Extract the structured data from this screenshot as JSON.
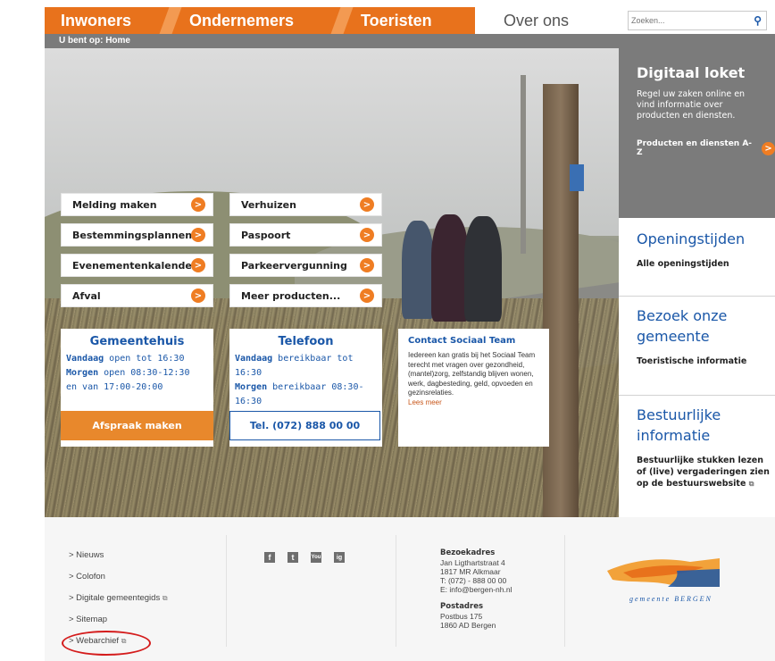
{
  "nav": {
    "tabs": [
      "Inwoners",
      "Ondernemers",
      "Toeristen",
      "Over ons"
    ],
    "search_placeholder": "Zoeken..."
  },
  "breadcrumb": "U bent op: Home",
  "hero_links": {
    "left": [
      "Melding maken",
      "Bestemmingsplannen",
      "Evenementenkalender",
      "Afval"
    ],
    "right": [
      "Verhuizen",
      "Paspoort",
      "Parkeervergunning",
      "Meer producten..."
    ]
  },
  "gemeentehuis": {
    "title": "Gemeentehuis",
    "line1_label": "Vandaag",
    "line1_text": " open tot 16:30",
    "line2_label": "Morgen",
    "line2_text": " open 08:30-12:30",
    "line3_text": "en van 17:00-20:00",
    "button": "Afspraak maken"
  },
  "telefoon": {
    "title": "Telefoon",
    "line1_label": "Vandaag",
    "line1_text": " bereikbaar tot 16:30",
    "line2_label": "Morgen",
    "line2_text": " bereikbaar 08:30-16:30",
    "button": "Tel. (072) 888 00 00"
  },
  "sociaal": {
    "title": "Contact Sociaal Team",
    "body": "Iedereen kan gratis bij het Sociaal Team terecht met vragen over gezondheid, (mantel)zorg, zelfstandig blijven wonen, werk, dagbesteding, geld, opvoeden en gezinsrelaties.",
    "more": "Lees meer"
  },
  "loket": {
    "title": "Digitaal loket",
    "desc": "Regel uw zaken online en vind informatie over producten en diensten.",
    "link": "Producten en diensten A-Z"
  },
  "right_blocks": [
    {
      "title": "Openingstijden",
      "link": "Alle openingstijden"
    },
    {
      "title": "Bezoek onze gemeente",
      "link": "Toeristische informatie"
    },
    {
      "title": "Bestuurlijke informatie",
      "link": "Bestuurlijke stukken lezen of (live) vergaderingen zien op de bestuurswebsite"
    }
  ],
  "footer": {
    "links": [
      "> Nieuws",
      "> Colofon",
      "> Digitale gemeentegids",
      "> Sitemap",
      "> Webarchief"
    ],
    "social": [
      "f",
      "t",
      "You",
      "ig"
    ],
    "bezoekadres_head": "Bezoekadres",
    "bezoekadres": [
      "Jan Ligthartstraat 4",
      "1817 MR Alkmaar",
      "T: (072) - 888 00 00",
      "E: info@bergen-nh.nl"
    ],
    "postadres_head": "Postadres",
    "postadres": [
      "Postbus 175",
      "1860 AD Bergen"
    ],
    "logo_text": "gemeente BERGEN"
  },
  "icons": {
    "search": "search-icon",
    "arrow": "arrow-right-icon",
    "external": "external-link-icon"
  },
  "colors": {
    "accent_orange": "#e8721c",
    "brand_blue": "#1a57a8",
    "loket_grey": "#7b7b7b"
  }
}
